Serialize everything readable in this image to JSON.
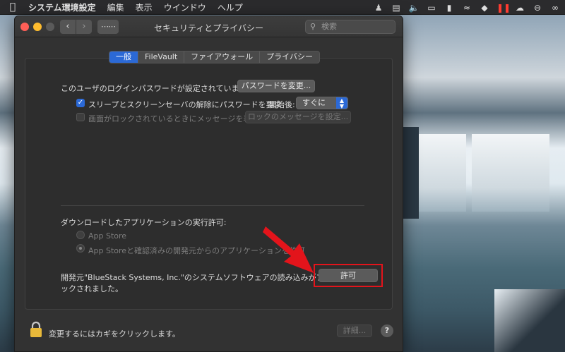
{
  "menubar": {
    "app_name": "システム環境設定",
    "items": [
      "編集",
      "表示",
      "ウインドウ",
      "ヘルプ"
    ]
  },
  "window": {
    "title": "セキュリティとプライバシー",
    "search_placeholder": "検索"
  },
  "tabs": [
    {
      "label": "一般",
      "active": true
    },
    {
      "label": "FileVault",
      "active": false
    },
    {
      "label": "ファイアウォール",
      "active": false
    },
    {
      "label": "プライバシー",
      "active": false
    }
  ],
  "general": {
    "password_set_text": "このユーザのログインパスワードが設定されています",
    "change_password_button": "パスワードを変更...",
    "require_password_label": "スリープとスクリーンセーバの解除にパスワードを要求",
    "require_password_checked": true,
    "after_label": "開始後:",
    "after_value": "すぐに",
    "lock_message_label": "画面がロックされているときにメッセージを表示",
    "lock_message_checked": false,
    "lock_message_button": "ロックのメッセージを設定..."
  },
  "downloads": {
    "heading": "ダウンロードしたアプリケーションの実行許可:",
    "option_app_store": "App Store",
    "option_identified": "App Storeと確認済みの開発元からのアプリケーションを許可",
    "selected": "option_identified",
    "blocked_message_line1": "開発元\"BlueStack Systems, Inc.\"のシステムソフトウェアの読み込みがブロ",
    "blocked_message_line2": "ックされました。",
    "allow_button": "許可"
  },
  "footer": {
    "lock_text": "変更するにはカギをクリックします。",
    "advanced_button": "詳細...",
    "help_button": "?"
  },
  "colors": {
    "accent": "#2b69d6",
    "highlight": "#e3141b",
    "window_bg": "#323232"
  }
}
